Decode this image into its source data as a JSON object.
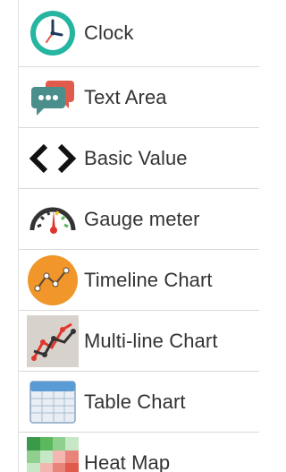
{
  "widgets": [
    {
      "label": "Clock",
      "icon": "clock-icon"
    },
    {
      "label": "Text Area",
      "icon": "chat-bubbles-icon"
    },
    {
      "label": "Basic Value",
      "icon": "code-brackets-icon"
    },
    {
      "label": "Gauge meter",
      "icon": "gauge-icon"
    },
    {
      "label": "Timeline Chart",
      "icon": "timeline-chart-icon"
    },
    {
      "label": "Multi-line Chart",
      "icon": "multi-line-chart-icon"
    },
    {
      "label": "Table Chart",
      "icon": "table-chart-icon"
    },
    {
      "label": "Heat Map",
      "icon": "heat-map-icon"
    }
  ],
  "colors": {
    "clock_ring": "#26b5a0",
    "bubble_teal": "#4a8f8c",
    "bubble_red": "#e05b4b",
    "timeline_orange": "#f0962a",
    "gauge_red": "#e0362c",
    "gauge_yellow": "#f2c418",
    "gauge_green": "#5cb85c"
  }
}
